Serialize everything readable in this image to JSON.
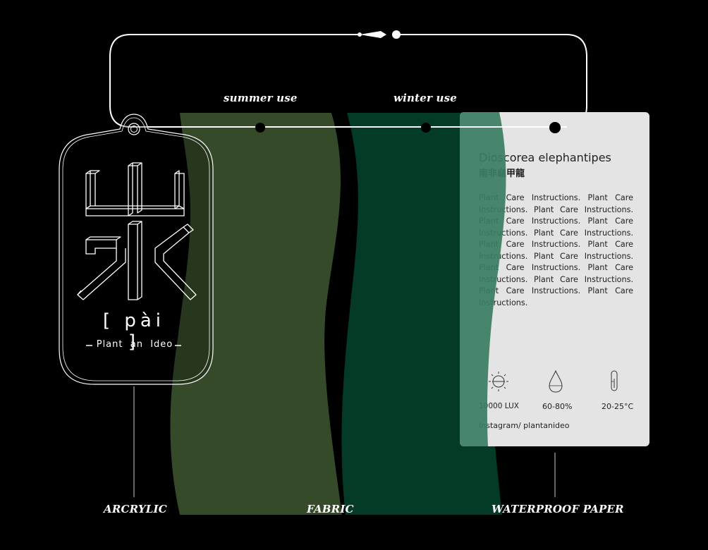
{
  "labels": {
    "summer_use": "summer use",
    "winter_use": "winter use",
    "acrylic": "ARCRYLIC",
    "fabric": "FABRIC",
    "waterproof_paper": "WATERPROOF PAPER"
  },
  "tag": {
    "pronunciation": "[ pài ]",
    "slogan": "Plant  an  Ideo"
  },
  "card": {
    "title": "Dioscorea elephantipes",
    "subtitle": "南非龜甲龍",
    "body": "Plant Care Instructions. Plant Care Instructions. Plant Care Instructions. Plant Care Instructions. Plant Care Instructions. Plant Care Instructions. Plant Care Instructions. Plant Care Instructions. Plant Care Instructions. Plant Care Instructions. Plant Care Instructions. Plant Care Instructions. Plant Care Instructions. Plant Care Instructions.",
    "light": "10000 LUX",
    "humidity": "60-80%",
    "temperature": "20-25°C",
    "instagram": "Instagram/ plantanideo"
  },
  "colors": {
    "background": "#000000",
    "summer_fabric": "#344a28",
    "winter_fabric": "#033b27",
    "card": "#e4e4e4",
    "overlay_green": "#3a7d63"
  }
}
